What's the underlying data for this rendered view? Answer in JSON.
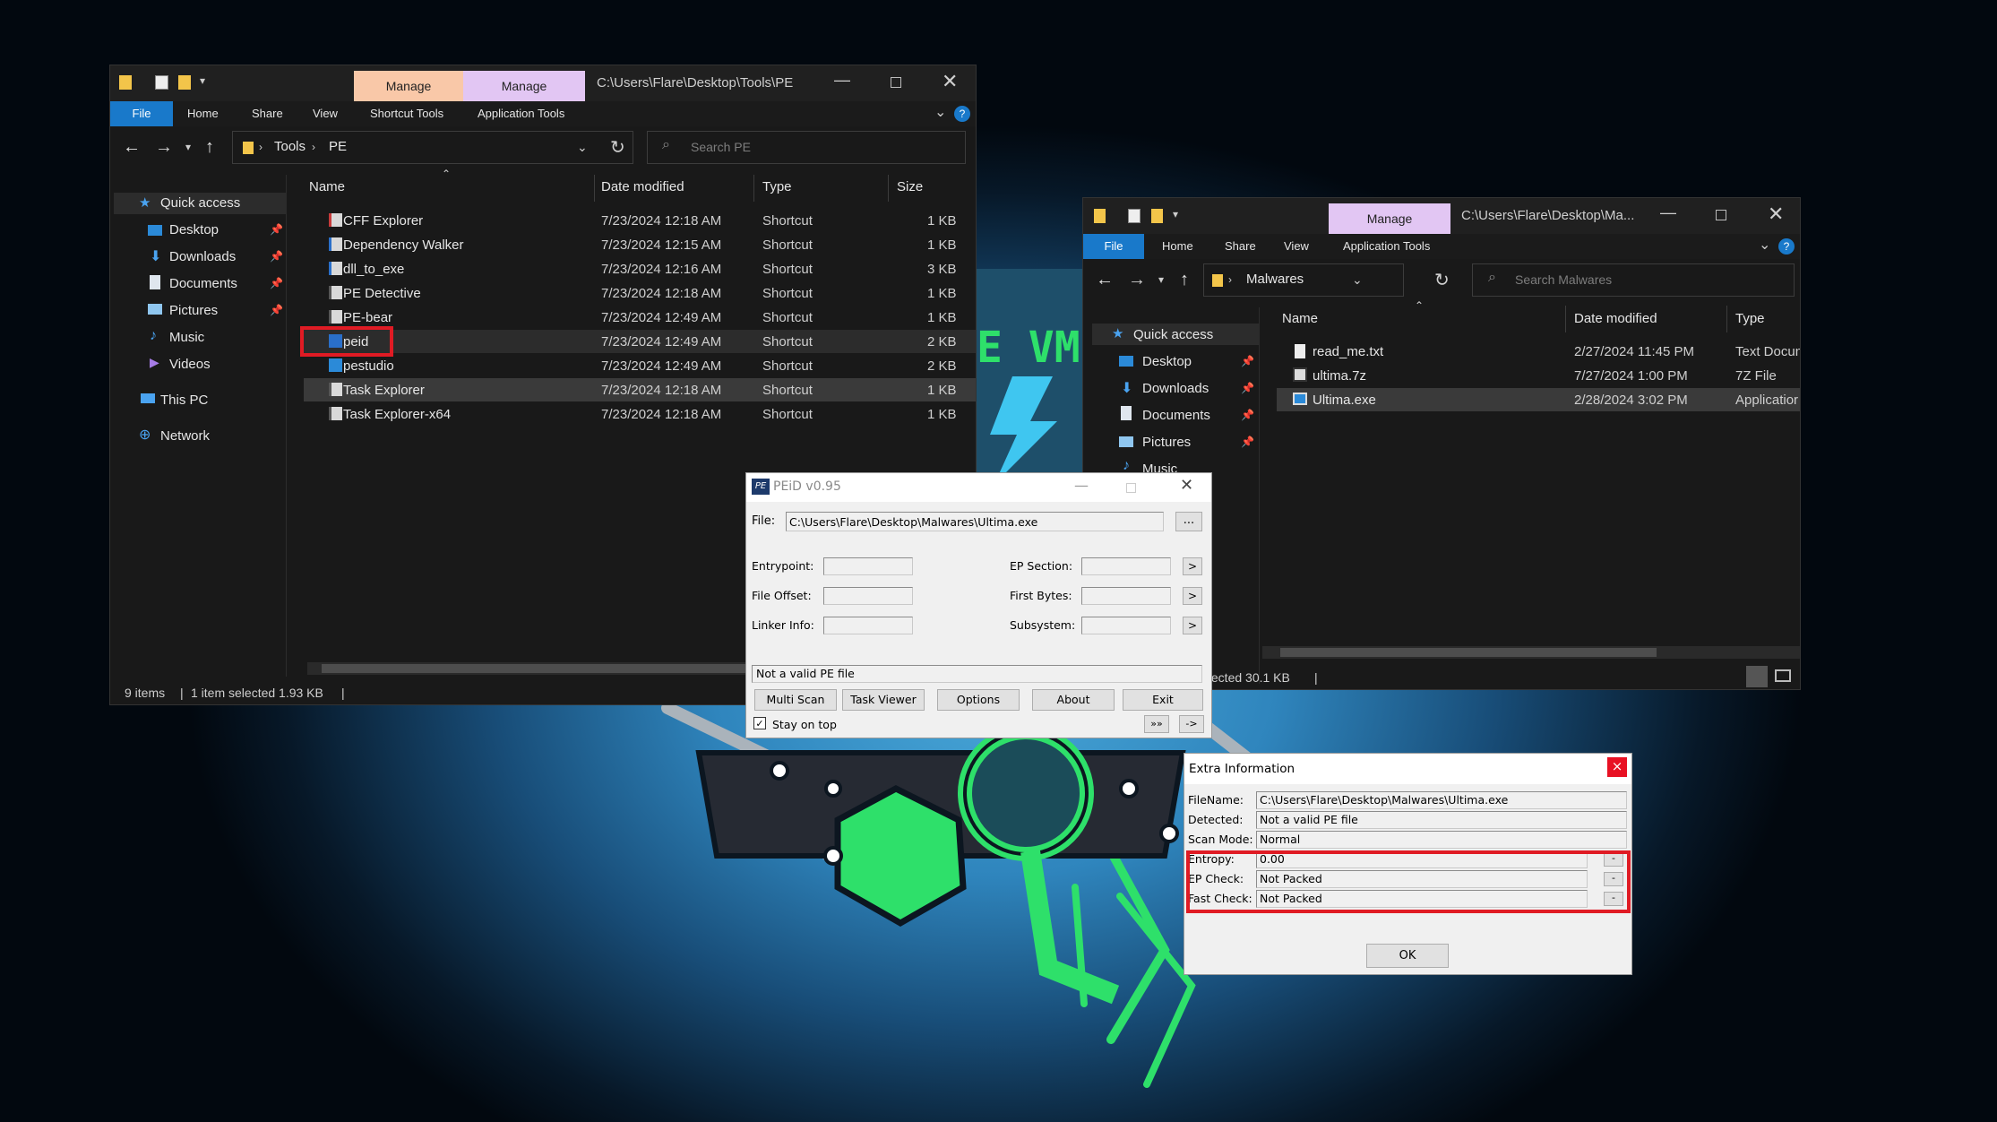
{
  "pe_window": {
    "manage1": "Manage",
    "manage2": "Manage",
    "path_title": "C:\\Users\\Flare\\Desktop\\Tools\\PE",
    "ribbon": {
      "file": "File",
      "home": "Home",
      "share": "Share",
      "view": "View",
      "shortcut_tools": "Shortcut Tools",
      "application_tools": "Application Tools"
    },
    "breadcrumb": {
      "tools": "Tools",
      "pe": "PE"
    },
    "search_placeholder": "Search PE",
    "columns": {
      "name": "Name",
      "date": "Date modified",
      "type": "Type",
      "size": "Size"
    },
    "nav": {
      "quick": "Quick access",
      "desktop": "Desktop",
      "downloads": "Downloads",
      "documents": "Documents",
      "pictures": "Pictures",
      "music": "Music",
      "videos": "Videos",
      "thispc": "This PC",
      "network": "Network"
    },
    "files": [
      {
        "name": "CFF Explorer",
        "date": "7/23/2024 12:18 AM",
        "type": "Shortcut",
        "size": "1 KB"
      },
      {
        "name": "Dependency Walker",
        "date": "7/23/2024 12:15 AM",
        "type": "Shortcut",
        "size": "1 KB"
      },
      {
        "name": "dll_to_exe",
        "date": "7/23/2024 12:16 AM",
        "type": "Shortcut",
        "size": "3 KB"
      },
      {
        "name": "PE Detective",
        "date": "7/23/2024 12:18 AM",
        "type": "Shortcut",
        "size": "1 KB"
      },
      {
        "name": "PE-bear",
        "date": "7/23/2024 12:49 AM",
        "type": "Shortcut",
        "size": "1 KB"
      },
      {
        "name": "peid",
        "date": "7/23/2024 12:49 AM",
        "type": "Shortcut",
        "size": "2 KB"
      },
      {
        "name": "pestudio",
        "date": "7/23/2024 12:49 AM",
        "type": "Shortcut",
        "size": "2 KB"
      },
      {
        "name": "Task Explorer",
        "date": "7/23/2024 12:18 AM",
        "type": "Shortcut",
        "size": "1 KB"
      },
      {
        "name": "Task Explorer-x64",
        "date": "7/23/2024 12:18 AM",
        "type": "Shortcut",
        "size": "1 KB"
      }
    ],
    "status": {
      "items": "9 items",
      "selected": "1 item selected  1.93 KB"
    }
  },
  "mal_window": {
    "manage": "Manage",
    "path_title": "C:\\Users\\Flare\\Desktop\\Ma...",
    "ribbon": {
      "file": "File",
      "home": "Home",
      "share": "Share",
      "view": "View",
      "application_tools": "Application Tools"
    },
    "breadcrumb": "Malwares",
    "search_placeholder": "Search Malwares",
    "columns": {
      "name": "Name",
      "date": "Date modified",
      "type": "Type"
    },
    "nav": {
      "quick": "Quick access",
      "desktop": "Desktop",
      "downloads": "Downloads",
      "documents": "Documents",
      "pictures": "Pictures",
      "music": "Music"
    },
    "files": [
      {
        "name": "read_me.txt",
        "date": "2/27/2024 11:45 PM",
        "type": "Text Docun"
      },
      {
        "name": "ultima.7z",
        "date": "7/27/2024 1:00 PM",
        "type": "7Z File"
      },
      {
        "name": "Ultima.exe",
        "date": "2/28/2024 3:02 PM",
        "type": "Applicatior"
      }
    ],
    "status": "elected  30.1 KB"
  },
  "bg_text": "E VM",
  "peid": {
    "title": "PEiD v0.95",
    "file_label": "File:",
    "file_value": "C:\\Users\\Flare\\Desktop\\Malwares\\Ultima.exe",
    "browse": "...",
    "entrypoint": "Entrypoint:",
    "file_offset": "File Offset:",
    "linker_info": "Linker Info:",
    "ep_section": "EP Section:",
    "first_bytes": "First Bytes:",
    "subsystem": "Subsystem:",
    "arrow": ">",
    "result": "Not a valid PE file",
    "buttons": {
      "multi_scan": "Multi Scan",
      "task_viewer": "Task Viewer",
      "options": "Options",
      "about": "About",
      "exit": "Exit"
    },
    "stay_on_top": "Stay on top",
    "more": "»»",
    "go": "->"
  },
  "extra": {
    "title": "Extra Information",
    "close": "×",
    "rows": [
      {
        "label": "FileName:",
        "value": "C:\\Users\\Flare\\Desktop\\Malwares\\Ultima.exe"
      },
      {
        "label": "Detected:",
        "value": "Not a valid PE file"
      },
      {
        "label": "Scan Mode:",
        "value": "Normal"
      },
      {
        "label": "Entropy:",
        "value": "0.00"
      },
      {
        "label": "EP Check:",
        "value": "Not Packed"
      },
      {
        "label": "Fast Check:",
        "value": "Not Packed"
      }
    ],
    "dash": "-",
    "ok": "OK"
  },
  "colors": {
    "accent": "#1979ca",
    "highlight": "#e01b24",
    "mascot_green": "#2ee06a"
  }
}
